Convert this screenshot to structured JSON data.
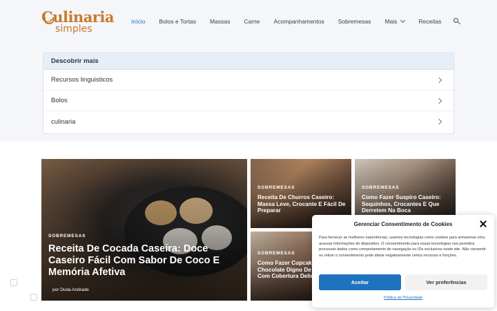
{
  "logo": {
    "top": "Culinaria",
    "bottom": "simples"
  },
  "nav": {
    "items": [
      {
        "label": "Início",
        "active": true
      },
      {
        "label": "Bolos e Tortas"
      },
      {
        "label": "Massas"
      },
      {
        "label": "Carne"
      },
      {
        "label": "Acompanhamentos"
      },
      {
        "label": "Sobremesas"
      },
      {
        "label": "Mais",
        "dropdown": true
      },
      {
        "label": "Receitas"
      }
    ],
    "search_icon": "search-icon"
  },
  "discover": {
    "heading": "Descobrir mais",
    "items": [
      "Recursos linguisticos",
      "Bolos",
      "culinaria"
    ]
  },
  "posts": [
    {
      "category": "SOBREMESAS",
      "title": "Receita De Cocada Caseira: Doce Caseiro Fácil Com Sabor De Coco E Memória Afetiva",
      "author": "por Duda Andrade"
    },
    {
      "category": "SOBREMESAS",
      "title": "Receita De Churros Caseiro: Massa Leve, Crocante E Fácil De Preparar"
    },
    {
      "category": "SOBREMESAS",
      "title": "Como Fazer Suspiro Caseiro: Sequinhos, Crocantes E Que Derretem Na Boca"
    },
    {
      "category": "SOBREMESAS",
      "title": "Como Fazer Cupcake De Chocolate Digno De Confeitaria Com Cobertura Deliciosa"
    }
  ],
  "cookie": {
    "title": "Gerenciar Consentimento de Cookies",
    "text": "Para fornecer as melhores experiências, usamos tecnologias como cookies para armazenar e/ou acessar informações do dispositivo. O consentimento para essas tecnologias nos permitirá processar dados como comportamento de navegação ou IDs exclusivos neste site. Não consentir ou retirar o consentimento pode afetar negativamente certos recursos e funções.",
    "accept": "Aceitar",
    "preferences": "Ver preferências",
    "policy": "Política de Privacidade"
  },
  "colors": {
    "accent": "#1e73be",
    "brand": "#c77a2a"
  }
}
